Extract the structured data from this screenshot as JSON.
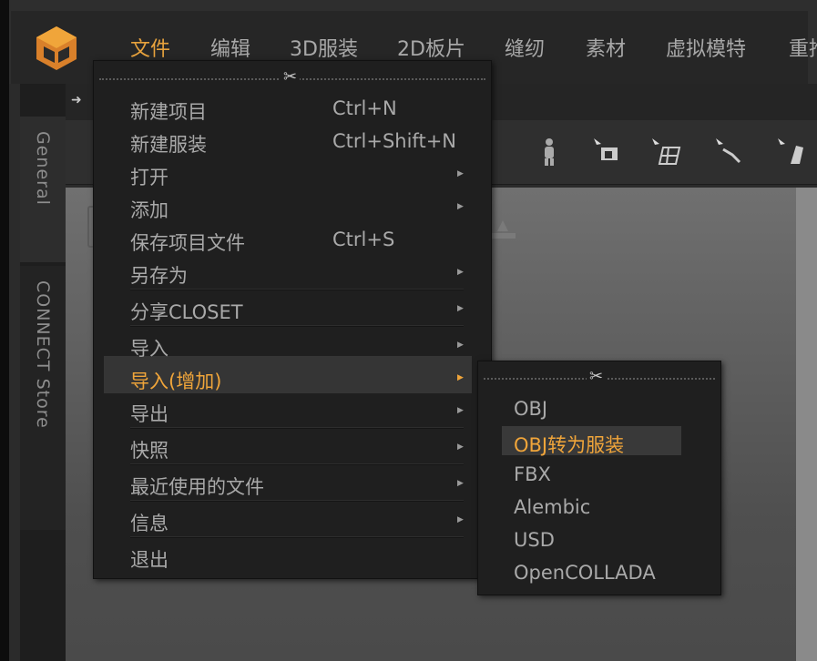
{
  "menubar": {
    "items": [
      "文件",
      "编辑",
      "3D服装",
      "2D板片",
      "缝纫",
      "素材",
      "虚拟模特",
      "重推"
    ]
  },
  "sidebar": {
    "tabs": [
      "General",
      "CONNECT Store"
    ]
  },
  "file_menu": {
    "items": [
      {
        "label": "新建项目",
        "shortcut": "Ctrl+N"
      },
      {
        "label": "新建服装",
        "shortcut": "Ctrl+Shift+N"
      },
      {
        "label": "打开",
        "shortcut": ""
      },
      {
        "label": "添加",
        "shortcut": ""
      },
      {
        "label": "保存项目文件",
        "shortcut": "Ctrl+S"
      },
      {
        "label": "另存为",
        "shortcut": ""
      },
      {
        "label": "分享CLOSET",
        "shortcut": ""
      },
      {
        "label": "导入",
        "shortcut": ""
      },
      {
        "label": "导入(增加)",
        "shortcut": ""
      },
      {
        "label": "导出",
        "shortcut": ""
      },
      {
        "label": "快照",
        "shortcut": ""
      },
      {
        "label": "最近使用的文件",
        "shortcut": ""
      },
      {
        "label": "信息",
        "shortcut": ""
      },
      {
        "label": "退出",
        "shortcut": ""
      }
    ]
  },
  "import_add_submenu": {
    "items": [
      "OBJ",
      "OBJ转为服装",
      "FBX",
      "Alembic",
      "USD",
      "OpenCOLLADA"
    ]
  },
  "colors": {
    "accent": "#f0a53a",
    "menu_bg": "#1f1f1f",
    "text": "#a9a9a9"
  }
}
